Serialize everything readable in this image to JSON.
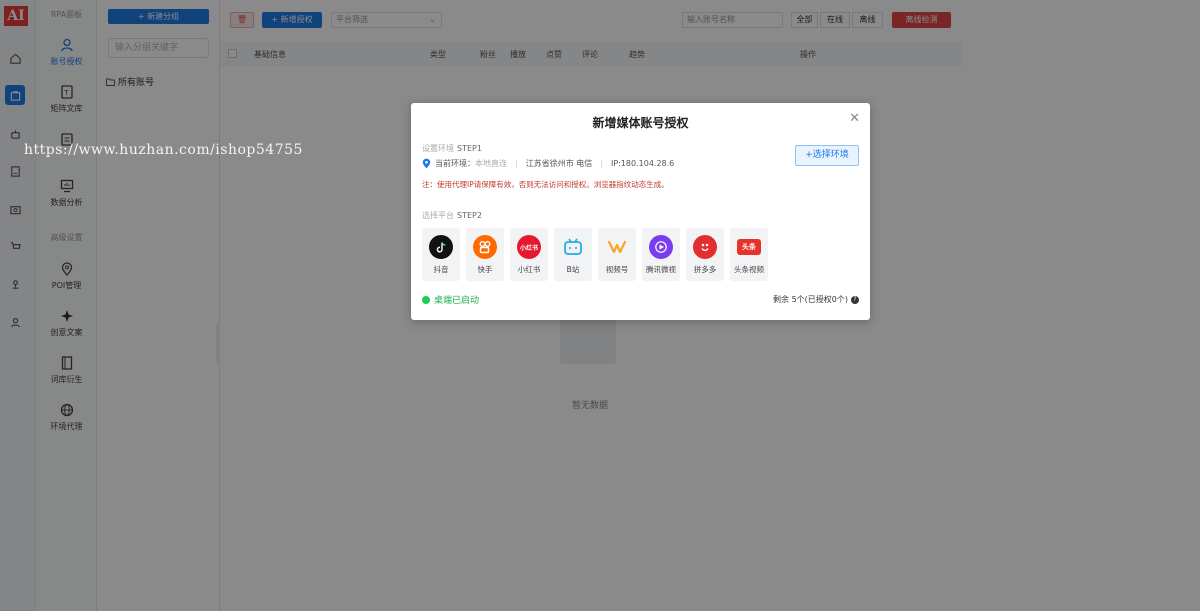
{
  "app": {
    "logo_text": "AI"
  },
  "menu": {
    "section_rpa": "RPA面板",
    "items": [
      {
        "label": "账号授权",
        "icon": "user-icon",
        "active": true
      },
      {
        "label": "矩阵文库",
        "icon": "library-icon"
      },
      {
        "label": "",
        "icon": "clipboard-icon"
      },
      {
        "label": "数据分析",
        "icon": "chart-icon"
      }
    ],
    "section_advanced": "高级设置",
    "advanced_items": [
      {
        "label": "POI管理",
        "icon": "location-icon"
      },
      {
        "label": "创意文案",
        "icon": "sparkle-icon"
      },
      {
        "label": "词库衍生",
        "icon": "book-icon"
      },
      {
        "label": "环境代理",
        "icon": "globe-icon"
      }
    ]
  },
  "groups": {
    "new_group_label": "+ 新建分组",
    "search_placeholder": "输入分组关键字",
    "all_accounts": "所有账号"
  },
  "toolbar": {
    "add_auth_label": "+ 新增授权",
    "platform_filter_placeholder": "平台筛选",
    "account_search_placeholder": "输入账号名称",
    "seg_all": "全部",
    "seg_online": "在线",
    "seg_offline": "离线",
    "offline_check_label": "离线检测"
  },
  "table": {
    "headers": [
      "基础信息",
      "类型",
      "粉丝",
      "播放",
      "点赞",
      "评论",
      "趋势",
      "操作"
    ],
    "empty_text": "暂无数据"
  },
  "watermark": "https://www.huzhan.com/ishop54755",
  "modal": {
    "title": "新增媒体账号授权",
    "step1_label": "设置环境",
    "step1_tag": "STEP1",
    "current_env_label": "当前环境：",
    "current_env_value": "本地直连",
    "location": "江苏省徐州市 电信",
    "ip": "IP:180.104.28.6",
    "choose_env_button": "+选择环境",
    "warning": "注：使用代理IP请保障有效，否则无法访问和授权。浏览器指纹动态生成。",
    "step2_label": "选择平台",
    "step2_tag": "STEP2",
    "platforms": [
      {
        "label": "抖音",
        "icon": "douyin-icon",
        "color": "#111111"
      },
      {
        "label": "快手",
        "icon": "kuaishou-icon",
        "color": "#ff6a00"
      },
      {
        "label": "小红书",
        "icon": "xiaohongshu-icon",
        "color": "#e5182f",
        "icon_text": "小红书"
      },
      {
        "label": "B站",
        "icon": "bilibili-icon",
        "color": "#22aee6"
      },
      {
        "label": "视频号",
        "icon": "shipinhao-icon",
        "color": "#f6a623"
      },
      {
        "label": "腾讯微视",
        "icon": "weishi-icon",
        "color": "#7b3cf0"
      },
      {
        "label": "拼多多",
        "icon": "pinduoduo-icon",
        "color": "#e22e2e"
      },
      {
        "label": "头条视频",
        "icon": "toutiao-icon",
        "color": "#e8312b",
        "icon_text": "头条"
      }
    ],
    "status_text": "桌端已启动",
    "remaining_text": "剩余 5个(已授权0个)"
  }
}
